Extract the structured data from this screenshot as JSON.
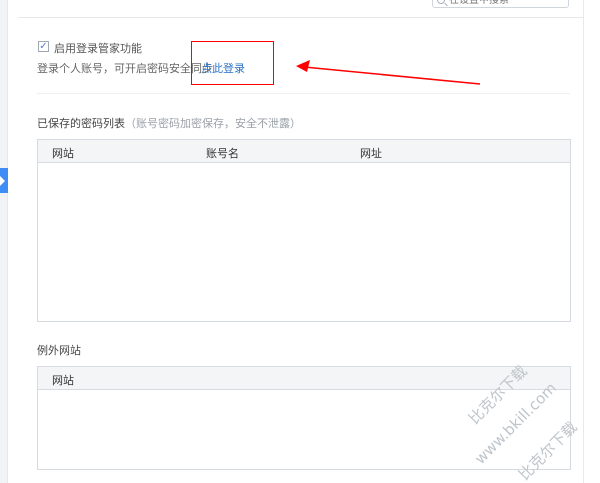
{
  "search": {
    "placeholder": "在设置中搜索"
  },
  "login_manager": {
    "checkbox_checked": true,
    "enable_label": "启用登录管家功能",
    "description": "登录个人账号，可开启密码安全同步",
    "login_link": "点此登录"
  },
  "saved_passwords": {
    "title": "已保存的密码列表",
    "note": "（账号密码加密保存，安全不泄露）",
    "columns": [
      "网站",
      "账号名",
      "网址"
    ]
  },
  "exceptions": {
    "title": "例外网站",
    "columns": [
      "网站"
    ]
  },
  "watermark": {
    "line1": "比克尔下载",
    "line2": "www.bkill.com",
    "line3": "比克尔下载"
  },
  "colors": {
    "accent": "#3f8cf6",
    "link": "#2b73c6",
    "annotation": "#ff0000",
    "border": "#d5dbe1"
  },
  "icons": {
    "search": "search-icon",
    "checkbox": "checkmark-icon",
    "annotation_arrow": "arrow-left-icon"
  }
}
